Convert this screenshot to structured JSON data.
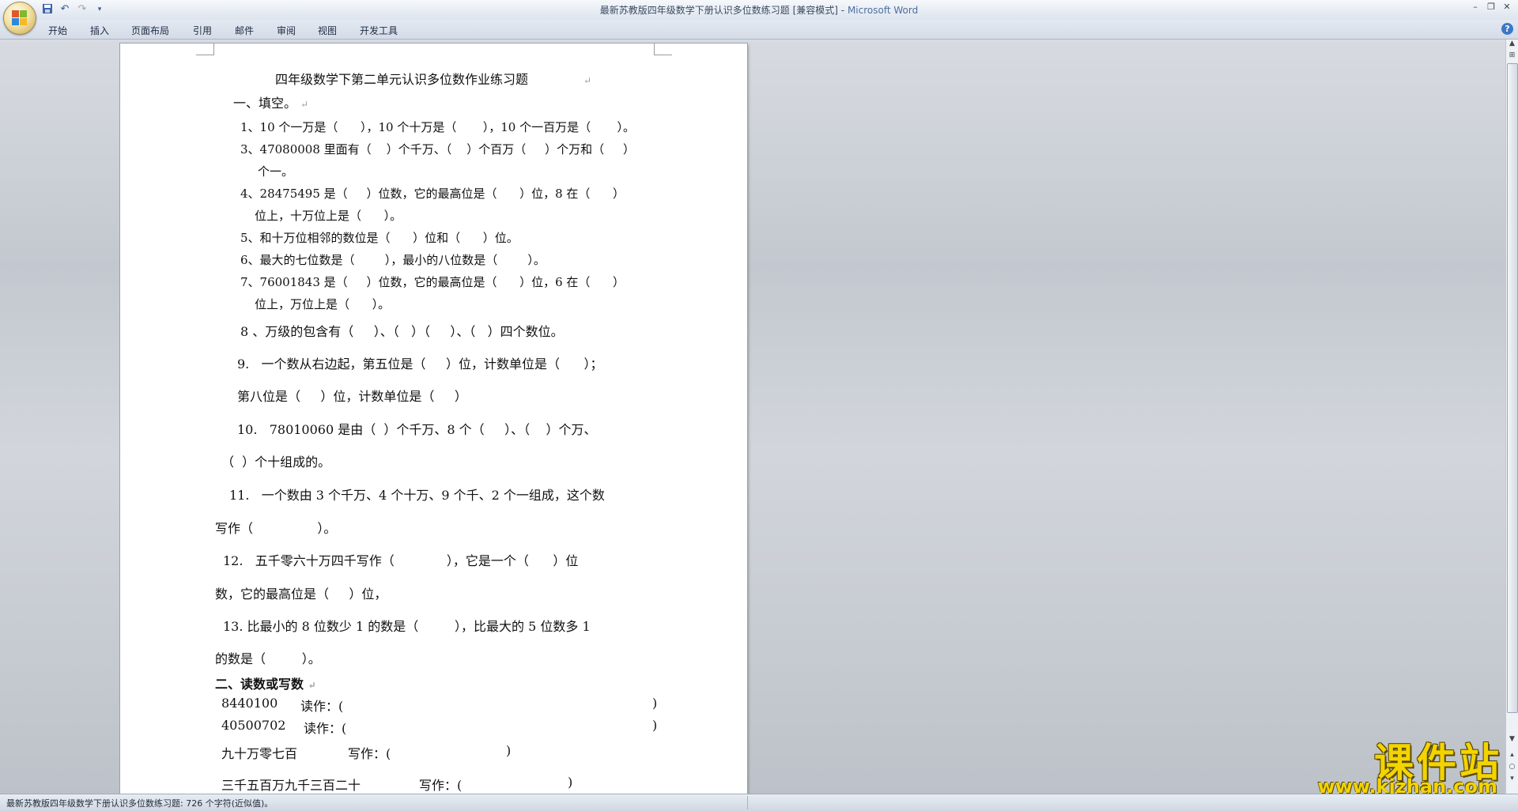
{
  "window": {
    "title": "最新苏教版四年级数学下册认识多位数练习题 [兼容模式]",
    "title_sep": " - ",
    "app_name": "Microsoft Word"
  },
  "qat": {
    "save_icon": "save-icon",
    "undo_icon": "undo-icon",
    "redo_icon": "redo-icon",
    "more": "▾"
  },
  "ribbon": {
    "tabs": [
      "开始",
      "插入",
      "页面布局",
      "引用",
      "邮件",
      "审阅",
      "视图",
      "开发工具"
    ],
    "help": "?"
  },
  "document": {
    "title": "四年级数学下第二单元认识多位数作业练习题",
    "section1": "一、填空。",
    "lines": [
      "1、10 个一万是（      ），10 个十万是（       ），10 个一百万是（       ）。",
      "3、47080008 里面有（    ）个千万、（    ）个百万（     ）个万和（     ）",
      "个一。",
      "4、28475495 是（     ）位数，它的最高位是（      ）位，8 在（      ）",
      "位上，十万位上是（      ）。",
      "5、和十万位相邻的数位是（      ）位和（      ）位。",
      "6、最大的七位数是（        ），最小的八位数是（        ）。",
      "7、76001843 是（     ）位数，它的最高位是（      ）位，6 在（      ）",
      "位上，万位上是（      ）。",
      "8 、万级的包含有（     ）、（   ）（     ）、（   ）四个数位。",
      "9.   一个数从右边起，第五位是（     ）位，计数单位是（      ）；",
      "第八位是（     ）位，计数单位是（     ）",
      "10.   78010060 是由（  ）个千万、8 个（     ）、（    ）个万、",
      "（  ）个十组成的。",
      "11.   一个数由 3 个千万、4 个十万、9 个千、2 个一组成，这个数",
      "写作（                ）。",
      "12.   五千零六十万四千写作（             ），它是一个（      ）位",
      "数，它的最高位是（     ）位，",
      "13. 比最小的 8 位数少 1 的数是（         ），比最大的 5 位数多 1",
      "的数是（         ）。"
    ],
    "section2": "二、读数或写数",
    "read_write": [
      {
        "num": "8440100",
        "label": "读作：(",
        "close": ")"
      },
      {
        "num": "40500702",
        "label": "读作：(",
        "close": ")"
      },
      {
        "num": "九十万零七百",
        "label": "写作：(",
        "close": ")"
      },
      {
        "num": "三千五百万九千三百二十",
        "label": "写作：(",
        "close": ")"
      }
    ],
    "para_mark": "↵"
  },
  "statusbar": {
    "text": "最新苏教版四年级数学下册认识多位数练习题: 726 个字符(近似值)。"
  },
  "watermark": {
    "text": "课件站",
    "url": "www.kjzhan.com"
  }
}
